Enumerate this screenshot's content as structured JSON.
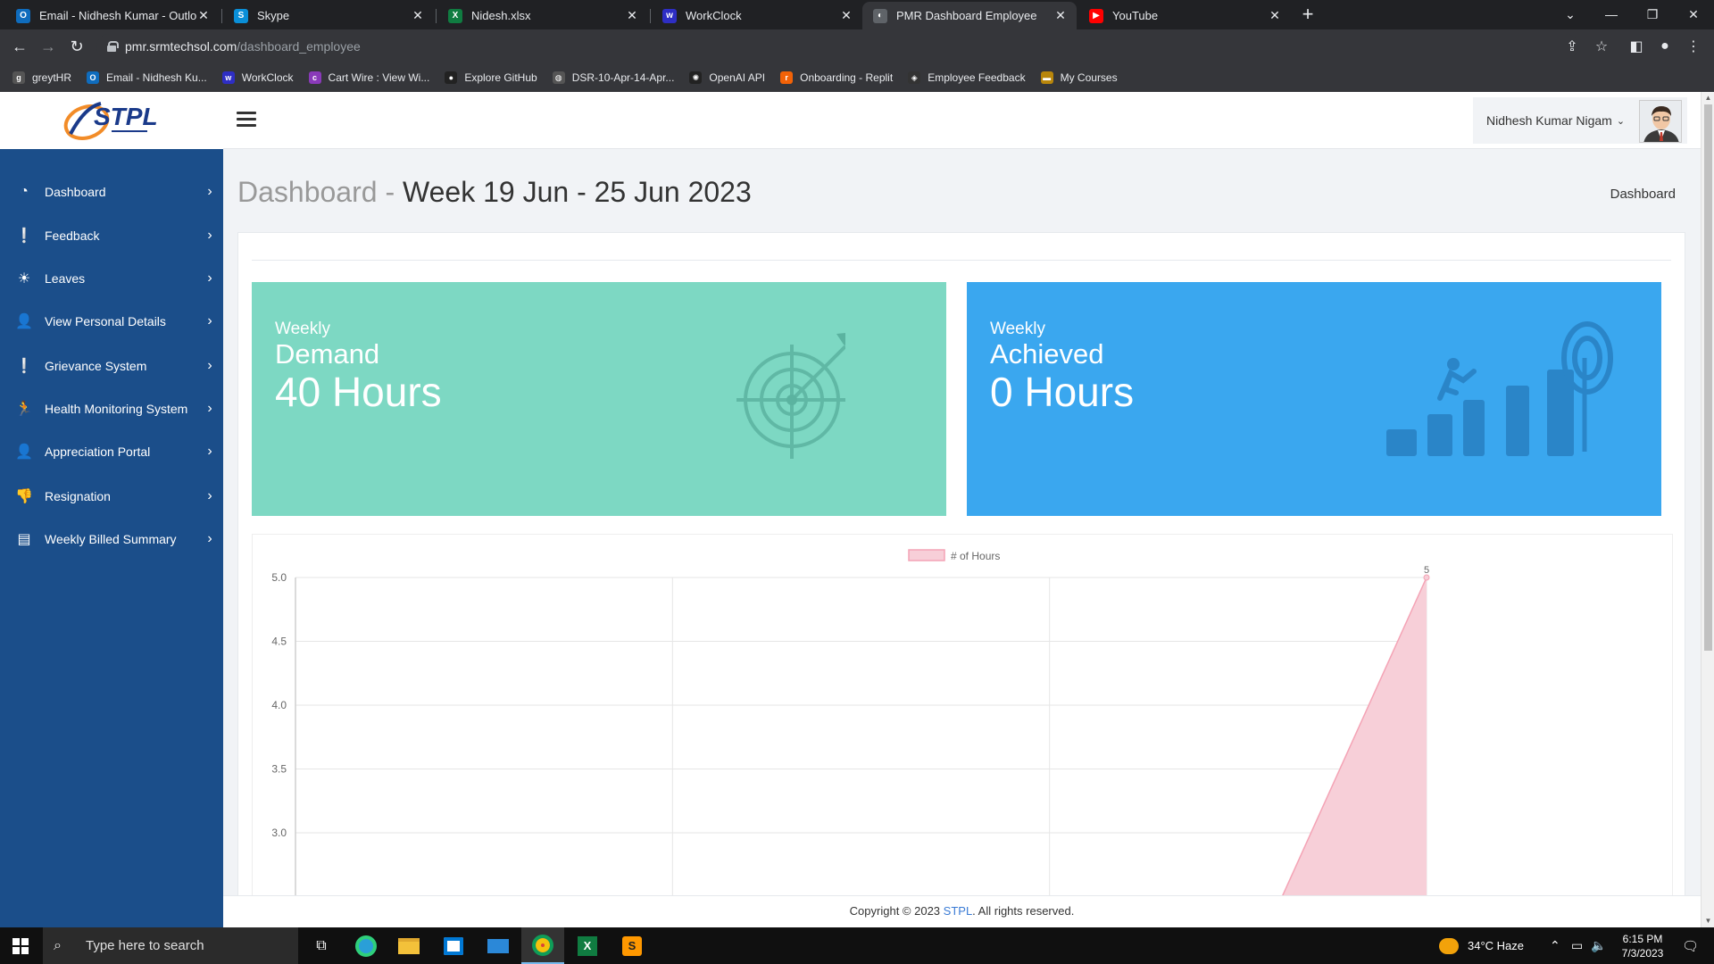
{
  "browser": {
    "tabs": [
      {
        "title": "Email - Nidhesh Kumar - Outlook",
        "icon": "outlook-icon",
        "color": "#0f6cbd",
        "glyph": "O"
      },
      {
        "title": "Skype",
        "icon": "skype-icon",
        "color": "#0a8fd8",
        "glyph": "S"
      },
      {
        "title": "Nidesh.xlsx",
        "icon": "excel-icon",
        "color": "#107c41",
        "glyph": "X"
      },
      {
        "title": "WorkClock",
        "icon": "workclock-icon",
        "color": "#2e2ec4",
        "glyph": "w"
      },
      {
        "title": "PMR Dashboard Employee",
        "icon": "page-icon",
        "color": "#5f6368",
        "glyph": "◐"
      },
      {
        "title": "YouTube",
        "icon": "youtube-icon",
        "color": "#ff0000",
        "glyph": "▶"
      }
    ],
    "url_host": "pmr.srmtechsol.com",
    "url_path": "/dashboard_employee",
    "bookmarks": [
      {
        "label": "greytHR",
        "icon": "greythr-icon",
        "color": "#555"
      },
      {
        "label": "Email - Nidhesh Ku...",
        "icon": "outlook-icon",
        "color": "#0f6cbd"
      },
      {
        "label": "WorkClock",
        "icon": "workclock-icon",
        "color": "#2e2ec4"
      },
      {
        "label": "Cart Wire : View Wi...",
        "icon": "cartwire-icon",
        "color": "#8a3ab9"
      },
      {
        "label": "Explore GitHub",
        "icon": "github-icon",
        "color": "#222"
      },
      {
        "label": "DSR-10-Apr-14-Apr...",
        "icon": "globe-icon",
        "color": "#555"
      },
      {
        "label": "OpenAI API",
        "icon": "openai-icon",
        "color": "#222"
      },
      {
        "label": "Onboarding - Replit",
        "icon": "replit-icon",
        "color": "#f26207"
      },
      {
        "label": "Employee Feedback",
        "icon": "feedback-icon",
        "color": "#333"
      },
      {
        "label": "My Courses",
        "icon": "courses-icon",
        "color": "#b8860b"
      }
    ]
  },
  "topbar": {
    "user_name": "Nidhesh Kumar Nigam"
  },
  "sidebar": {
    "items": [
      {
        "label": "Dashboard",
        "icon": "dashboard-icon",
        "glyph": "◔"
      },
      {
        "label": "Feedback",
        "icon": "feedback-icon",
        "glyph": "❕"
      },
      {
        "label": "Leaves",
        "icon": "sun-icon",
        "glyph": "☀"
      },
      {
        "label": "View Personal Details",
        "icon": "user-icon",
        "glyph": "👤"
      },
      {
        "label": "Grievance System",
        "icon": "comment-alert-icon",
        "glyph": "❕"
      },
      {
        "label": "Health Monitoring System",
        "icon": "running-icon",
        "glyph": "🏃"
      },
      {
        "label": "Appreciation Portal",
        "icon": "user-icon",
        "glyph": "👤"
      },
      {
        "label": "Resignation",
        "icon": "thumbs-down-icon",
        "glyph": "👎"
      },
      {
        "label": "Weekly Billed Summary",
        "icon": "billing-icon",
        "glyph": "▤"
      }
    ]
  },
  "main": {
    "title_prefix": "Dashboard -",
    "title_week": "Week 19 Jun - 25 Jun 2023",
    "breadcrumb": "Dashboard",
    "cards": [
      {
        "kicker": "Weekly",
        "name": "Demand",
        "value": "40 Hours"
      },
      {
        "kicker": "Weekly",
        "name": "Achieved",
        "value": "0 Hours"
      }
    ]
  },
  "chart_data": {
    "type": "area",
    "legend": "# of Hours",
    "series": [
      {
        "name": "# of Hours",
        "color": "#f7cfd8",
        "stroke": "#f4a3b5",
        "points": [
          [
            0.0,
            0
          ],
          [
            0.6,
            0
          ],
          [
            0.85,
            2.43
          ],
          [
            1.0,
            5
          ]
        ]
      }
    ],
    "point_label": "5",
    "yticks": [
      "5.0",
      "4.5",
      "4.0",
      "3.5",
      "3.0"
    ],
    "ylim": [
      2.5,
      5.0
    ],
    "grid": true
  },
  "footer": {
    "prefix": "Copyright © 2023 ",
    "link": "STPL",
    "suffix": ". All rights reserved."
  },
  "taskbar": {
    "search_placeholder": "Type here to search",
    "weather": "34°C  Haze",
    "time": "6:15 PM",
    "date": "7/3/2023"
  }
}
